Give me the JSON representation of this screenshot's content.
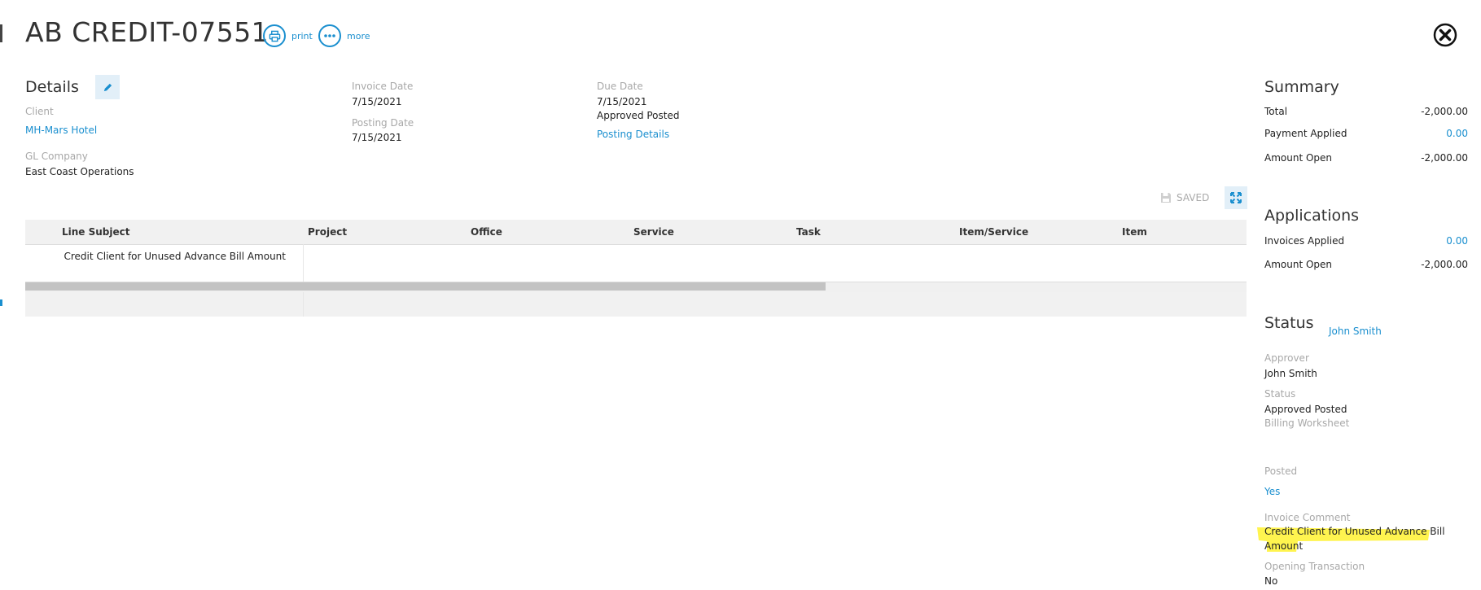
{
  "header": {
    "title": "AB CREDIT-07551",
    "print_label": "print",
    "more_label": "more"
  },
  "details": {
    "heading": "Details",
    "client_label": "Client",
    "client_value": "MH-Mars Hotel",
    "gl_company_label": "GL Company",
    "gl_company_value": "East Coast Operations",
    "invoice_date_label": "Invoice Date",
    "invoice_date_value": "7/15/2021",
    "posting_date_label": "Posting Date",
    "posting_date_value": "7/15/2021",
    "due_date_label": "Due Date",
    "due_date_value": "7/15/2021",
    "approval_status": "Approved Posted",
    "posting_details_link": "Posting Details"
  },
  "toolbar": {
    "saved_label": "SAVED"
  },
  "grid": {
    "columns": [
      "Line Subject",
      "Project",
      "Office",
      "Service",
      "Task",
      "Item/Service",
      "Item"
    ],
    "rows": [
      {
        "line_subject": "Credit Client for Unused Advance Bill Amount"
      }
    ],
    "scroll_fraction": 0.655
  },
  "summary": {
    "heading": "Summary",
    "total_label": "Total",
    "total_value": "-2,000.00",
    "payment_applied_label": "Payment Applied",
    "payment_applied_value": "0.00",
    "amount_open_label": "Amount Open",
    "amount_open_value": "-2,000.00"
  },
  "applications": {
    "heading": "Applications",
    "invoices_applied_label": "Invoices Applied",
    "invoices_applied_value": "0.00",
    "amount_open_label": "Amount Open",
    "amount_open_value": "-2,000.00"
  },
  "status": {
    "heading": "Status",
    "owner_link": "John Smith",
    "approver_label": "Approver",
    "approver_value": "John Smith",
    "status_label": "Status",
    "status_value": "Approved Posted",
    "billing_worksheet_label": "Billing Worksheet",
    "posted_label": "Posted",
    "posted_value": "Yes",
    "invoice_comment_label": "Invoice Comment",
    "invoice_comment_line1": "Credit Client for Unused Advance Bill",
    "invoice_comment_line2": "Amount",
    "opening_transaction_label": "Opening Transaction",
    "opening_transaction_value": "No"
  },
  "colors": {
    "accent": "#1a8fcf",
    "highlight": "#fff44f",
    "grid_header_bg": "#f1f1f1"
  },
  "icons": {
    "print": "printer-icon",
    "more": "ellipsis-icon",
    "close": "close-circle-icon",
    "edit": "pencil-icon",
    "saved": "floppy-disk-icon",
    "expand": "expand-arrows-icon"
  }
}
